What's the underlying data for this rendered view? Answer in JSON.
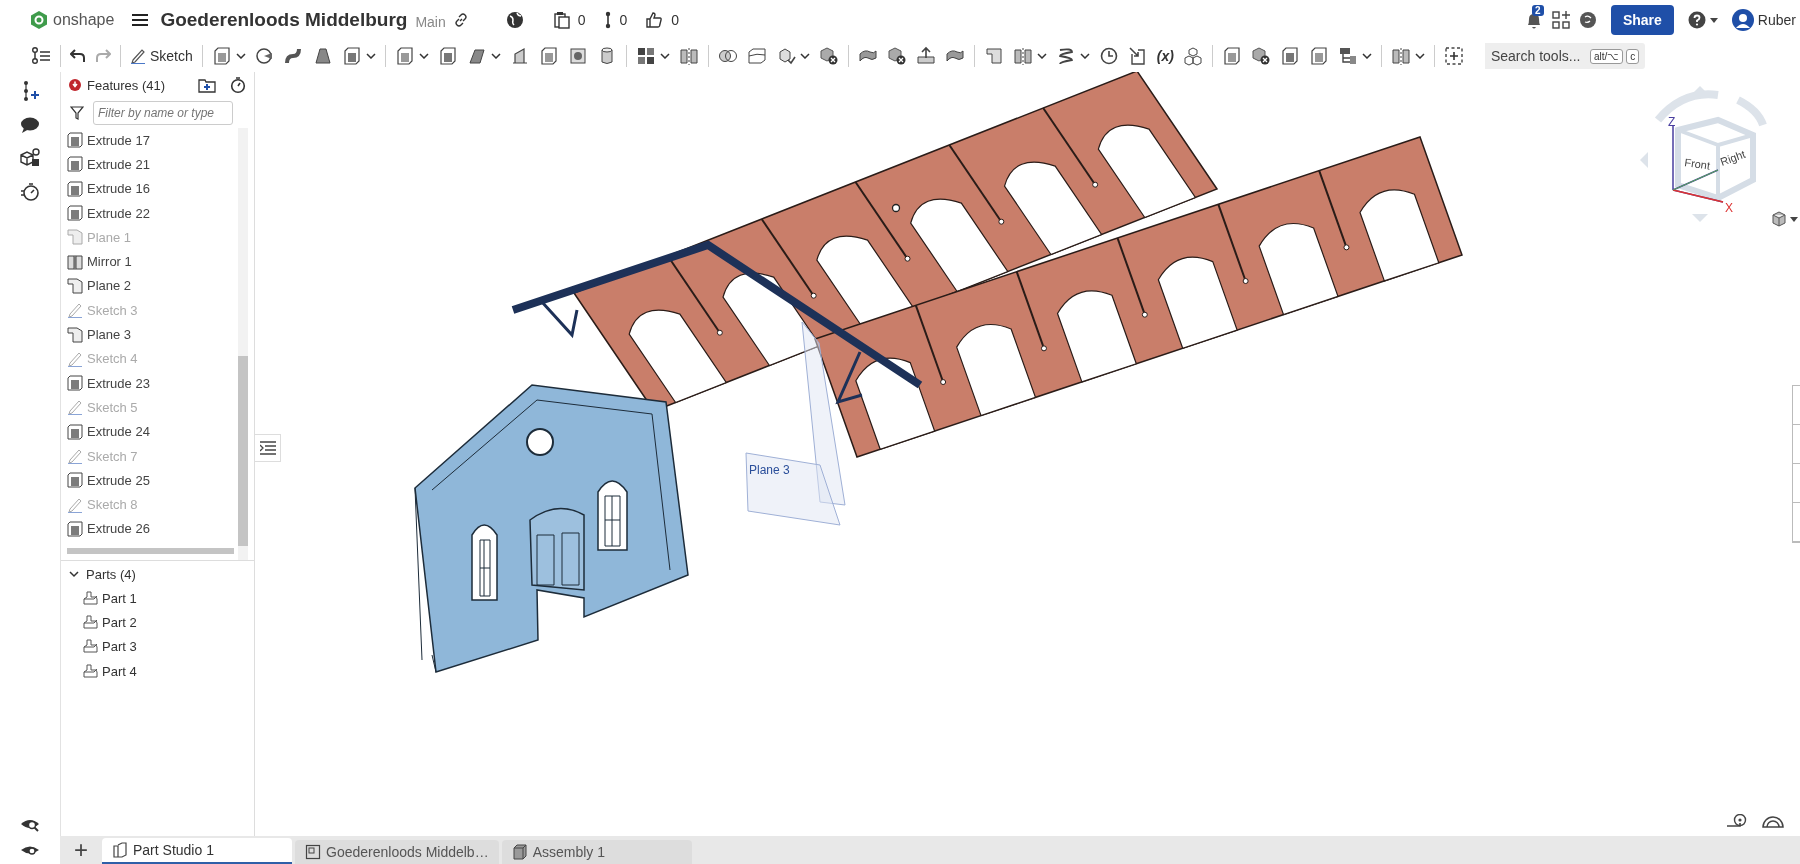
{
  "top_bar": {
    "logo": "onshape",
    "title": "Goederenloods Middelburg",
    "branch": "Main",
    "counters": [
      "0",
      "0",
      "0"
    ],
    "notification_badge": "2",
    "share_button": "Share",
    "user": "Ruber"
  },
  "toolbar": {
    "sketch_button": "Sketch",
    "variable_button": "(x)",
    "search": {
      "placeholder": "Search tools...",
      "shortcut_keys": [
        "alt/⌥",
        "c"
      ]
    }
  },
  "features": {
    "title": "Features (41)",
    "filter_placeholder": "Filter by name or type",
    "items": [
      {
        "name": "Extrude 17",
        "kind": "extrude",
        "hidden": false
      },
      {
        "name": "Extrude 21",
        "kind": "extrude",
        "hidden": false
      },
      {
        "name": "Extrude 16",
        "kind": "extrude",
        "hidden": false
      },
      {
        "name": "Extrude 22",
        "kind": "extrude",
        "hidden": false
      },
      {
        "name": "Plane 1",
        "kind": "plane",
        "hidden": true
      },
      {
        "name": "Mirror 1",
        "kind": "mirror",
        "hidden": false
      },
      {
        "name": "Plane 2",
        "kind": "plane",
        "hidden": false
      },
      {
        "name": "Sketch 3",
        "kind": "sketch",
        "hidden": true
      },
      {
        "name": "Plane 3",
        "kind": "plane",
        "hidden": false
      },
      {
        "name": "Sketch 4",
        "kind": "sketch",
        "hidden": true
      },
      {
        "name": "Extrude 23",
        "kind": "extrude",
        "hidden": false
      },
      {
        "name": "Sketch 5",
        "kind": "sketch",
        "hidden": true
      },
      {
        "name": "Extrude 24",
        "kind": "extrude",
        "hidden": false
      },
      {
        "name": "Sketch 7",
        "kind": "sketch",
        "hidden": true
      },
      {
        "name": "Extrude 25",
        "kind": "extrude",
        "hidden": false
      },
      {
        "name": "Sketch 8",
        "kind": "sketch",
        "hidden": true
      },
      {
        "name": "Extrude 26",
        "kind": "extrude",
        "hidden": false
      }
    ]
  },
  "parts": {
    "title": "Parts (4)",
    "expanded": true,
    "items": [
      "Part 1",
      "Part 2",
      "Part 3",
      "Part 4"
    ]
  },
  "viewport": {
    "plane_label": "Plane 3",
    "view_cube": {
      "faces": [
        "Front",
        "Right"
      ],
      "axes": [
        "Z",
        "X"
      ]
    }
  },
  "bottom_tabs": {
    "add_button": "+",
    "tabs": [
      {
        "label": "Part Studio 1",
        "kind": "part_studio",
        "selected": true
      },
      {
        "label": "Goederenloods Middelb…",
        "kind": "drawing",
        "selected": false
      },
      {
        "label": "Assembly 1",
        "kind": "assembly",
        "selected": false
      }
    ]
  }
}
